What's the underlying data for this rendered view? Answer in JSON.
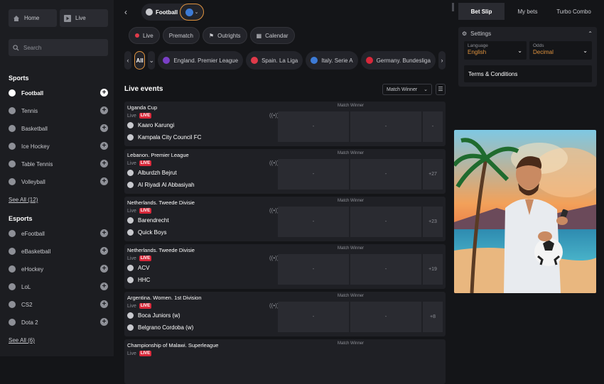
{
  "sidebar": {
    "home_label": "Home",
    "live_label": "Live",
    "search_placeholder": "Search",
    "sports_title": "Sports",
    "sports": [
      {
        "label": "Football",
        "icon": "football-icon",
        "active": true
      },
      {
        "label": "Tennis",
        "icon": "tennis-icon"
      },
      {
        "label": "Basketball",
        "icon": "basketball-icon"
      },
      {
        "label": "Ice Hockey",
        "icon": "ice-hockey-icon"
      },
      {
        "label": "Table Tennis",
        "icon": "table-tennis-icon"
      },
      {
        "label": "Volleyball",
        "icon": "volleyball-icon"
      }
    ],
    "sports_see_all": "See All (12)",
    "esports_title": "Esports",
    "esports": [
      {
        "label": "eFootball",
        "icon": "efootball-icon"
      },
      {
        "label": "eBasketball",
        "icon": "ebasketball-icon"
      },
      {
        "label": "eHockey",
        "icon": "ehockey-icon"
      },
      {
        "label": "LoL",
        "icon": "lol-icon"
      },
      {
        "label": "CS2",
        "icon": "cs2-icon"
      },
      {
        "label": "Dota 2",
        "icon": "dota2-icon"
      }
    ],
    "esports_see_all": "See All (6)"
  },
  "header": {
    "sport_label": "Football"
  },
  "filters": {
    "live": "Live",
    "prematch": "Prematch",
    "outrights": "Outrights",
    "calendar": "Calendar"
  },
  "leagues": {
    "all": "All",
    "items": [
      {
        "label": "England. Premier League",
        "color": "#7a3fc7"
      },
      {
        "label": "Spain. La Liga",
        "color": "#e03a4a"
      },
      {
        "label": "Italy. Serie A",
        "color": "#3d7bd6"
      },
      {
        "label": "Germany. Bundesliga",
        "color": "#d8283a"
      }
    ]
  },
  "live_events": {
    "title": "Live events",
    "market_select": "Match Winner",
    "live_text": "Live",
    "live_badge": "LIVE",
    "market_label": "Match Winner",
    "events": [
      {
        "league": "Uganda Cup",
        "team1": "Kaaro Karungi",
        "team2": "Kampala City Council FC",
        "odds": [
          "-",
          "-"
        ],
        "more": "-"
      },
      {
        "league": "Lebanon. Premier League",
        "team1": "Alburdzh Bejrut",
        "team2": "Al Riyadi Al Abbasiyah",
        "odds": [
          "-",
          "-"
        ],
        "more": "+27"
      },
      {
        "league": "Netherlands. Tweede Divisie",
        "team1": "Barendrecht",
        "team2": "Quick Boys",
        "odds": [
          "-",
          "-"
        ],
        "more": "+23"
      },
      {
        "league": "Netherlands. Tweede Divisie",
        "team1": "ACV",
        "team2": "HHC",
        "odds": [
          "-",
          "-"
        ],
        "more": "+19"
      },
      {
        "league": "Argentina. Women. 1st Division",
        "team1": "Boca Juniors (w)",
        "team2": "Belgrano Cordoba (w)",
        "odds": [
          "-",
          "-"
        ],
        "more": "+8"
      },
      {
        "league": "Championship of Malawi. Superleague",
        "team1": "",
        "team2": "",
        "odds": [
          "",
          ""
        ],
        "more": ""
      }
    ]
  },
  "betslip": {
    "tabs": [
      "Bet Slip",
      "My bets",
      "Turbo Combo"
    ],
    "settings_title": "Settings",
    "language_label": "Language",
    "language_value": "English",
    "odds_label": "Odds",
    "odds_value": "Decimal",
    "terms": "Terms & Conditions"
  },
  "colors": {
    "accent": "#e0933e",
    "live_red": "#d8283a"
  }
}
